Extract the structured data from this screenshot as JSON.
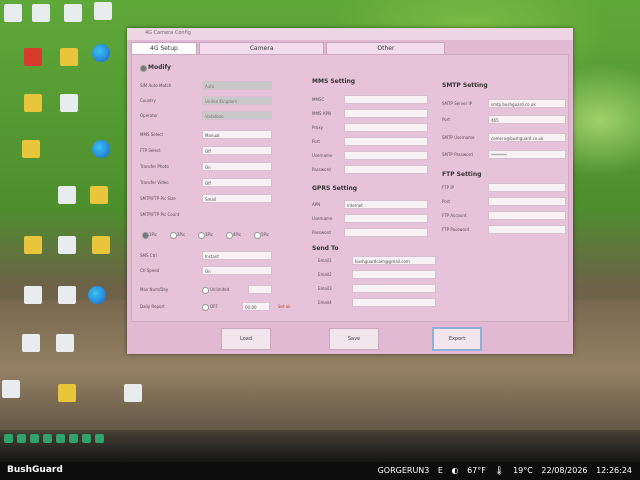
{
  "window": {
    "title": "4G Camera Config",
    "tabs": [
      "4G Setup",
      "Camera",
      "Other"
    ]
  },
  "modify": {
    "title": "Modify",
    "rows": [
      {
        "label": "SIM Auto Match",
        "value": "Auto"
      },
      {
        "label": "Country",
        "value": "United Kingdom"
      },
      {
        "label": "Operator",
        "value": "Vodafone"
      },
      {
        "label": "MMS Select",
        "value": "Manual"
      },
      {
        "label": "FTP Select",
        "value": "Off"
      },
      {
        "label": "Transfer Photo",
        "value": "On"
      },
      {
        "label": "Transfer Video",
        "value": "Off"
      },
      {
        "label": "SMTP/FTP Pic Size",
        "value": "Small"
      },
      {
        "label": "SMTP/FTP Pic Count",
        "value": ""
      }
    ],
    "counts": [
      "1Pic",
      "2Pic",
      "3Pic",
      "4Pic",
      "5Pic"
    ],
    "extra": [
      {
        "label": "SMS Ctrl",
        "value": "Instant"
      },
      {
        "label": "Ctl Speed",
        "value": "On"
      }
    ],
    "max_num": {
      "label": "Max Num/Day",
      "option": "Unlimited",
      "value": ""
    },
    "daily": {
      "label": "Daily Report",
      "option": "OFF",
      "value": "00:00",
      "warn": "Set ok"
    }
  },
  "mms": {
    "title": "MMS Setting",
    "rows": [
      {
        "label": "MMSC",
        "value": ""
      },
      {
        "label": "MMS APN",
        "value": ""
      },
      {
        "label": "Proxy",
        "value": ""
      },
      {
        "label": "Port",
        "value": ""
      },
      {
        "label": "Username",
        "value": ""
      },
      {
        "label": "Password",
        "value": ""
      }
    ]
  },
  "gprs": {
    "title": "GPRS Setting",
    "rows": [
      {
        "label": "APN",
        "value": "internet"
      },
      {
        "label": "Username",
        "value": ""
      },
      {
        "label": "Password",
        "value": ""
      }
    ]
  },
  "sendto": {
    "title": "Send To",
    "rows": [
      {
        "label": "Email1",
        "value": "bushguardcam@gmail.com"
      },
      {
        "label": "Email2",
        "value": ""
      },
      {
        "label": "Email3",
        "value": ""
      },
      {
        "label": "Email4",
        "value": ""
      }
    ]
  },
  "smtp": {
    "title": "SMTP Setting",
    "rows": [
      {
        "label": "SMTP Server IP",
        "value": "smtp.bushguard.co.uk"
      },
      {
        "label": "Port",
        "value": "465"
      },
      {
        "label": "SMTP Username",
        "value": "camera@bushguard.co.uk"
      },
      {
        "label": "SMTP Password",
        "value": "********"
      }
    ]
  },
  "ftp": {
    "title": "FTP Setting",
    "rows": [
      {
        "label": "FTP IP",
        "value": ""
      },
      {
        "label": "Port",
        "value": ""
      },
      {
        "label": "FTP Account",
        "value": ""
      },
      {
        "label": "FTP Password",
        "value": ""
      }
    ]
  },
  "buttons": {
    "load": "Load",
    "save": "Save",
    "export": "Export"
  },
  "taskbar": {
    "brand": "BushGuard",
    "camera": "GORGERUN3",
    "direction": "E",
    "temp_f": "67°F",
    "temp_c": "19°C",
    "date": "22/08/2026",
    "time": "12:26:24"
  },
  "colors": {
    "window_bg": "#e2b9d3",
    "field_bg": "#f8f1f6",
    "taskbar": "#0d0d0d"
  }
}
